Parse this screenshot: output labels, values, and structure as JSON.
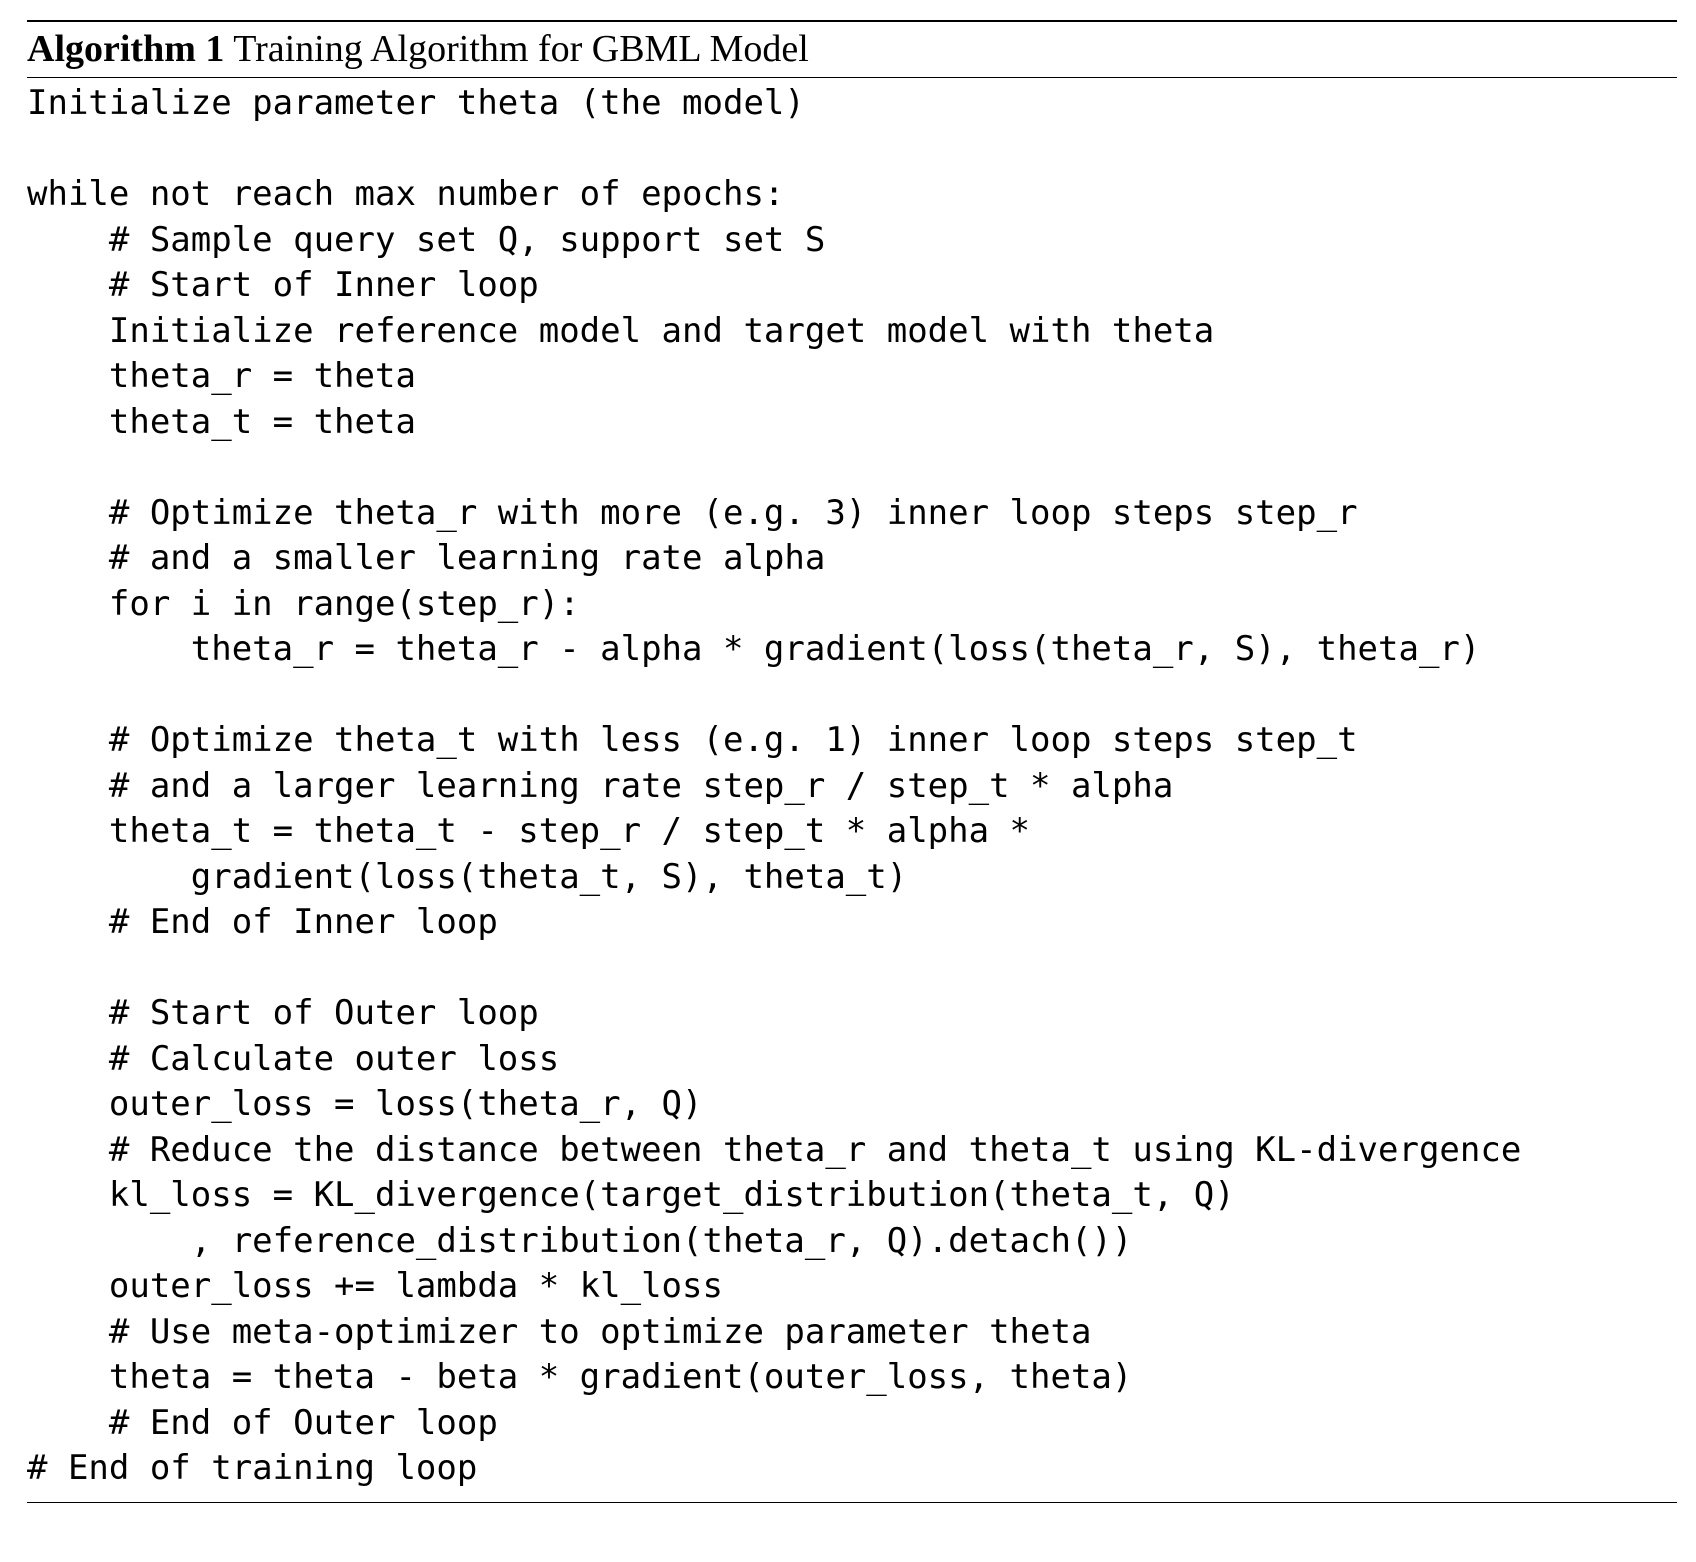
{
  "caption": {
    "label": "Algorithm 1",
    "title": "Training Algorithm for GBML Model"
  },
  "code_lines": [
    "Initialize parameter theta (the model)",
    "",
    "while not reach max number of epochs:",
    "    # Sample query set Q, support set S",
    "    # Start of Inner loop",
    "    Initialize reference model and target model with theta",
    "    theta_r = theta",
    "    theta_t = theta",
    "",
    "    # Optimize theta_r with more (e.g. 3) inner loop steps step_r",
    "    # and a smaller learning rate alpha",
    "    for i in range(step_r):",
    "        theta_r = theta_r - alpha * gradient(loss(theta_r, S), theta_r)",
    "",
    "    # Optimize theta_t with less (e.g. 1) inner loop steps step_t",
    "    # and a larger learning rate step_r / step_t * alpha",
    "    theta_t = theta_t - step_r / step_t * alpha *",
    "        gradient(loss(theta_t, S), theta_t)",
    "    # End of Inner loop",
    "",
    "    # Start of Outer loop",
    "    # Calculate outer loss",
    "    outer_loss = loss(theta_r, Q)",
    "    # Reduce the distance between theta_r and theta_t using KL-divergence",
    "    kl_loss = KL_divergence(target_distribution(theta_t, Q)",
    "        , reference_distribution(theta_r, Q).detach())",
    "    outer_loss += lambda * kl_loss",
    "    # Use meta-optimizer to optimize parameter theta",
    "    theta = theta - beta * gradient(outer_loss, theta)",
    "    # End of Outer loop",
    "# End of training loop"
  ]
}
